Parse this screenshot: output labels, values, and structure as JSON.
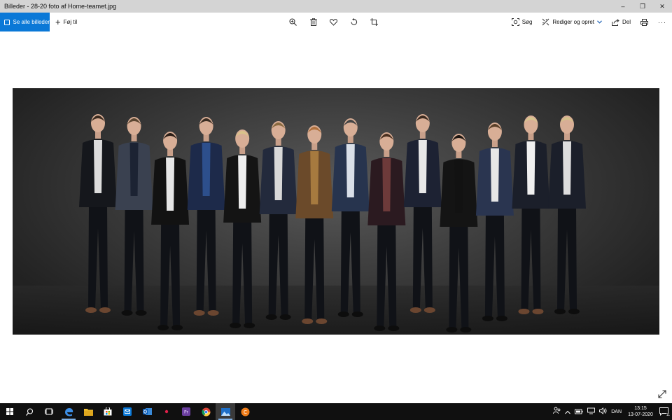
{
  "window": {
    "title": "Billeder - 28-20 foto af Home-teamet.jpg",
    "minimize": "–",
    "restore": "❐",
    "close": "✕"
  },
  "toolbar": {
    "see_all_label": "Se alle billeder",
    "add_to_label": "Føj til",
    "center_tools": [
      "zoom-icon",
      "delete-icon",
      "heart-icon",
      "rotate-icon",
      "crop-icon"
    ],
    "search_label": "Søg",
    "edit_label": "Rediger og opret",
    "share_label": "Del",
    "more_label": "···"
  },
  "photo": {
    "people_count": 14
  },
  "taskbar": {
    "apps": [
      "start-icon",
      "search-icon",
      "task-view-icon",
      "edge-icon",
      "file-explorer-icon",
      "store-icon",
      "mail-icon",
      "outlook-icon",
      "media-icon",
      "premiere-icon",
      "chrome-icon",
      "photos-icon",
      "hp-icon"
    ],
    "language": "DAN",
    "time": "13:15",
    "date": "13-07-2020",
    "notification_count": "11"
  },
  "colors": {
    "accent": "#0a78d7",
    "taskbar": "#101010",
    "titlebar": "#d4d4d4"
  }
}
